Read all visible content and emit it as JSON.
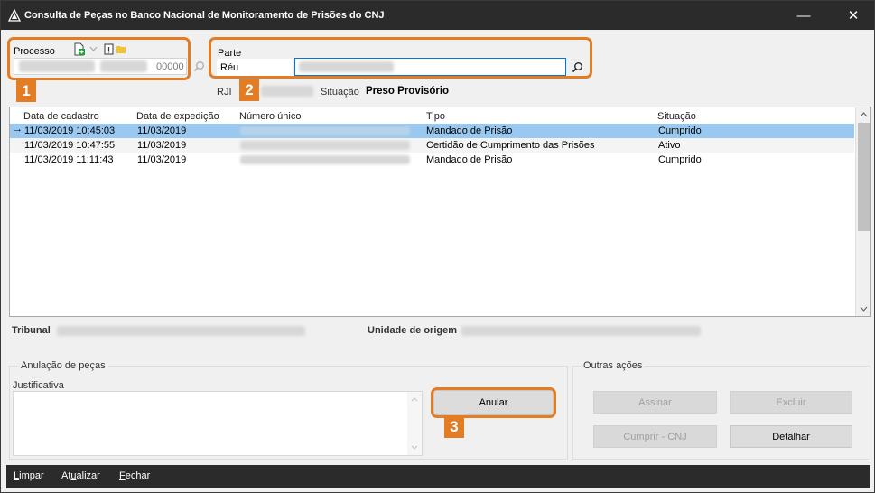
{
  "window": {
    "title": "Consulta de Peças no Banco Nacional de Monitoramento de Prisões do CNJ",
    "minimize_glyph": "—",
    "close_glyph": "✕"
  },
  "processo": {
    "label": "Processo",
    "code_value": "00000",
    "icons": [
      "document-add-icon",
      "chevron-down-icon",
      "note-icon",
      "folder-icon",
      "search-icon"
    ]
  },
  "parte": {
    "label": "Parte",
    "type_value": "Réu"
  },
  "rji": {
    "label": "RJI",
    "situacao_label": "Situação",
    "situacao_value": "Preso Provisório"
  },
  "annotations": {
    "badge1": "1",
    "badge2": "2",
    "badge3": "3",
    "accent": "#e47c24"
  },
  "grid": {
    "columns": [
      "Data de cadastro",
      "Data de expedição",
      "Número único",
      "Tipo",
      "Situação"
    ],
    "rows": [
      {
        "cadastro": "11/03/2019 10:45:03",
        "expedicao": "11/03/2019",
        "tipo": "Mandado de Prisão",
        "situacao": "Cumprido",
        "selected": true,
        "marker": "→"
      },
      {
        "cadastro": "11/03/2019 10:47:55",
        "expedicao": "11/03/2019",
        "tipo": "Certidão de Cumprimento das Prisões",
        "situacao": "Ativo",
        "selected": false,
        "marker": ""
      },
      {
        "cadastro": "11/03/2019 11:11:43",
        "expedicao": "11/03/2019",
        "tipo": "Mandado de Prisão",
        "situacao": "Cumprido",
        "selected": false,
        "marker": ""
      }
    ],
    "selection_color": "#99c9f0"
  },
  "info": {
    "tribunal_label": "Tribunal",
    "unidade_label": "Unidade de origem"
  },
  "anulacao": {
    "group_label": "Anulação de peças",
    "justificativa_label": "Justificativa",
    "anular_button": "Anular"
  },
  "outras_acoes": {
    "group_label": "Outras ações",
    "assinar": "Assinar",
    "excluir": "Excluir",
    "cumprir": "Cumprir - CNJ",
    "detalhar": "Detalhar"
  },
  "statusbar": {
    "limpar_prefix": "",
    "limpar_key": "L",
    "limpar_rest": "impar",
    "atualizar_prefix": "At",
    "atualizar_key": "u",
    "atualizar_rest": "alizar",
    "fechar_prefix": "",
    "fechar_key": "F",
    "fechar_rest": "echar"
  }
}
